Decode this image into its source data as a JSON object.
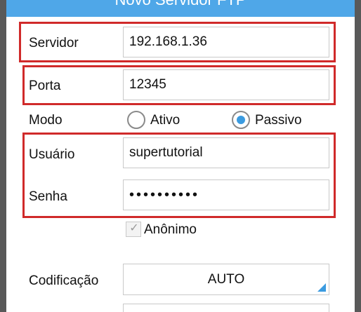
{
  "dialog": {
    "title": "Novo Servidor FTP"
  },
  "form": {
    "server_label": "Servidor",
    "server_value": "192.168.1.36",
    "port_label": "Porta",
    "port_value": "12345",
    "mode_label": "Modo",
    "mode_options": [
      "Ativo",
      "Passivo"
    ],
    "mode_selected": "Passivo",
    "user_label": "Usuário",
    "user_value": "supertutorial",
    "password_label": "Senha",
    "password_value": "••••••••••",
    "anonymous_label": "Anônimo",
    "anonymous_checked": true,
    "encoding_label": "Codificação",
    "encoding_value": "AUTO"
  },
  "colors": {
    "accent": "#3b9be0",
    "title_bar": "#4fa7e8",
    "highlight": "#d02a2a",
    "side_frame": "#595959"
  }
}
